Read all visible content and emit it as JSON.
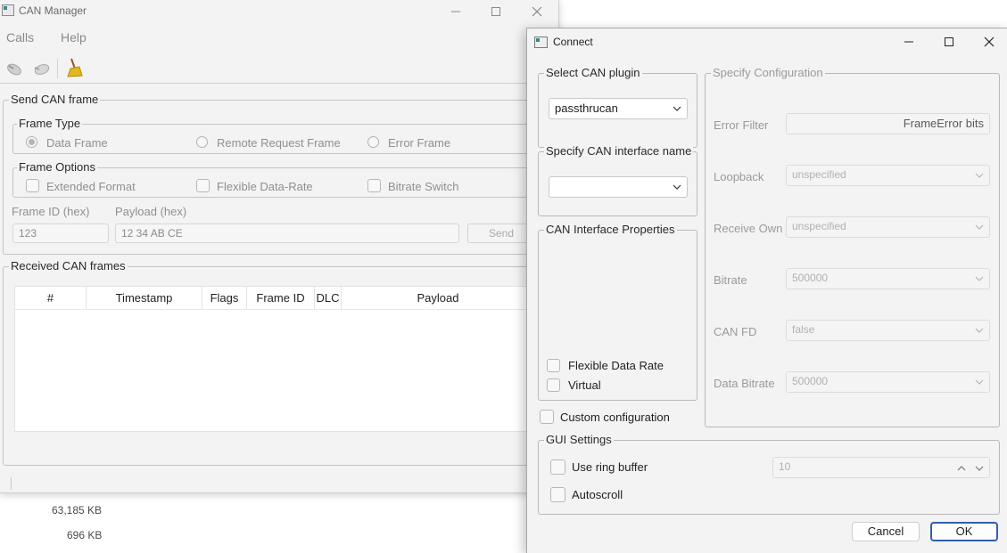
{
  "main_window": {
    "title": "CAN Manager",
    "menu": [
      "Calls",
      "Help"
    ],
    "send_frame": {
      "title": "Send CAN frame",
      "frame_type": {
        "title": "Frame Type",
        "options": [
          "Data Frame",
          "Remote Request Frame",
          "Error Frame"
        ],
        "selected": "Data Frame"
      },
      "frame_options": {
        "title": "Frame Options",
        "options": [
          "Extended Format",
          "Flexible Data-Rate",
          "Bitrate Switch"
        ]
      },
      "frame_id_label": "Frame ID (hex)",
      "payload_label": "Payload (hex)",
      "frame_id_value": "123",
      "payload_value": "12 34 AB CE",
      "send_label": "Send"
    },
    "received": {
      "title": "Received CAN frames",
      "columns": [
        "#",
        "Timestamp",
        "Flags",
        "Frame ID",
        "DLC",
        "Payload"
      ]
    }
  },
  "background_text": {
    "size1": "63,185 KB",
    "size2": "696 KB"
  },
  "dialog": {
    "title": "Connect",
    "select_plugin": {
      "title": "Select CAN plugin",
      "value": "passthrucan"
    },
    "interface_name": {
      "title": "Specify CAN interface name",
      "value": ""
    },
    "interface_properties": {
      "title": "CAN Interface Properties",
      "flexible_data_rate": "Flexible Data Rate",
      "virtual": "Virtual"
    },
    "custom_configuration": "Custom configuration",
    "specify_configuration": {
      "title": "Specify Configuration",
      "error_filter_label": "Error Filter",
      "error_filter_value": "FrameError bits",
      "loopback_label": "Loopback",
      "loopback_value": "unspecified",
      "receive_own_label": "Receive Own",
      "receive_own_value": "unspecified",
      "bitrate_label": "Bitrate",
      "bitrate_value": "500000",
      "can_fd_label": "CAN FD",
      "can_fd_value": "false",
      "data_bitrate_label": "Data Bitrate",
      "data_bitrate_value": "500000"
    },
    "gui_settings": {
      "title": "GUI Settings",
      "use_ring_buffer": "Use ring buffer",
      "ring_buffer_value": "10",
      "autoscroll": "Autoscroll"
    },
    "cancel_label": "Cancel",
    "ok_label": "OK"
  },
  "colors": {
    "ok_border": "#2f5fad",
    "window_bg": "#f3f3f3"
  }
}
